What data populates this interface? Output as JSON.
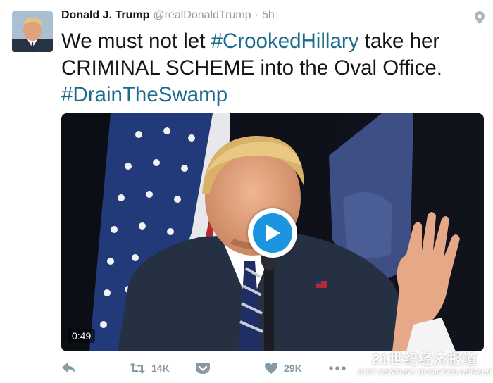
{
  "tweet": {
    "author_name": "Donald J. Trump",
    "handle": "@realDonaldTrump",
    "separator": "·",
    "time": "5h",
    "text_part1": "We must not let ",
    "hashtag1": "#CrookedHillary",
    "text_part2": " take her CRIMINAL SCHEME into the Oval Office.",
    "hashtag2": "#DrainTheSwamp"
  },
  "video": {
    "duration": "0:49"
  },
  "actions": {
    "retweet_count": "14K",
    "like_count": "29K"
  },
  "watermark": {
    "main": "21世纪经济报道",
    "sub": "21ST CENTURY BUSINESS HERALD"
  },
  "colors": {
    "hashtag": "#1b6b8c",
    "play_button": "#1b95e0",
    "action_gray": "#8899a6"
  },
  "icons": [
    "location-pin-icon",
    "play-icon",
    "reply-icon",
    "retweet-icon",
    "pocket-icon",
    "heart-icon",
    "more-icon"
  ]
}
